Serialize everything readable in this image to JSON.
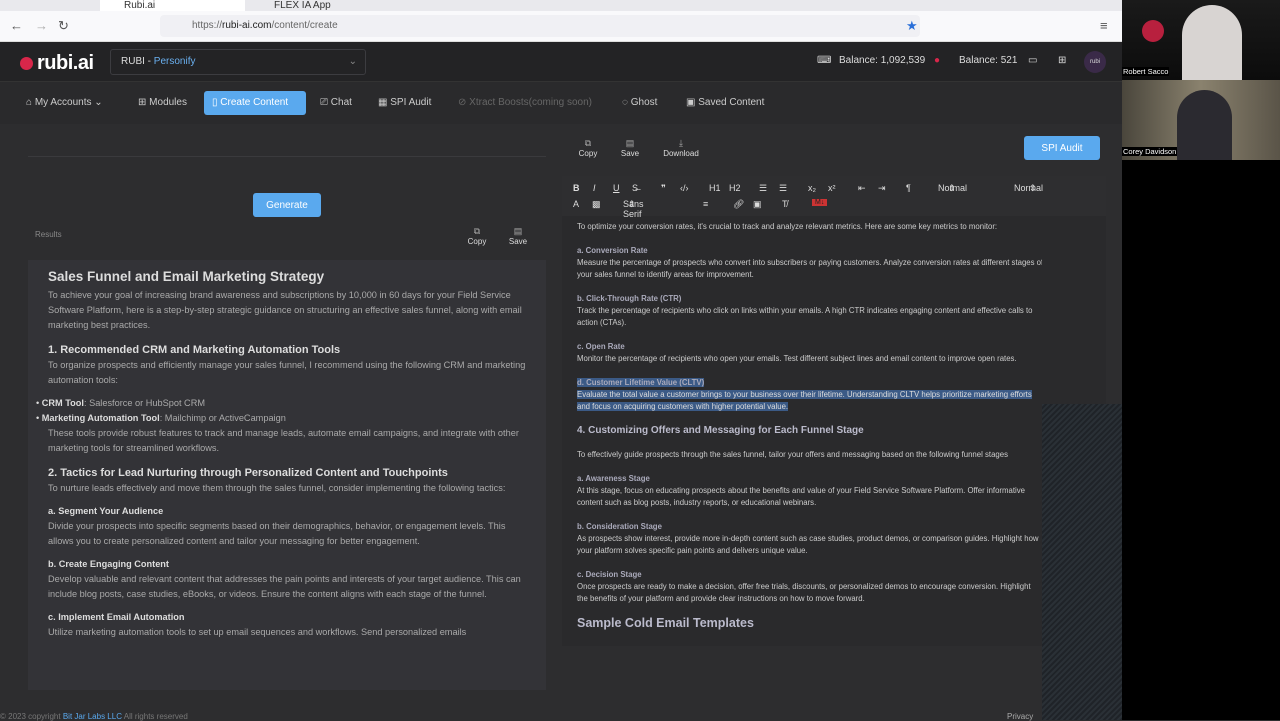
{
  "browser": {
    "tabs": [
      "Rubi.ai",
      "FLEX IA App"
    ],
    "url_domain": "rubi-ai.com",
    "url_path": "/content/create",
    "url_scheme": "https://"
  },
  "header": {
    "logo": "rubi.ai",
    "persona_prefix": "RUBI - ",
    "persona_name": "Personify",
    "balance_tokens": "Balance: 1,092,539",
    "balance_credits": "Balance: 521"
  },
  "nav": [
    {
      "label": "My Accounts ⌄",
      "icon": "home-icon"
    },
    {
      "label": "Modules",
      "icon": "grid-icon"
    },
    {
      "label": "Create Content",
      "icon": "document-icon",
      "active": true
    },
    {
      "label": "Chat",
      "icon": "chat-icon"
    },
    {
      "label": "SPI Audit",
      "icon": "map-icon"
    },
    {
      "label": "Xtract Boosts(coming soon)",
      "icon": "rocket-icon",
      "disabled": true
    },
    {
      "label": "Ghost",
      "icon": "ghost-icon"
    },
    {
      "label": "Saved Content",
      "icon": "save-icon"
    }
  ],
  "left": {
    "generate": "Generate",
    "results": "Results",
    "copy": "Copy",
    "save": "Save",
    "title": "Sales Funnel and Email Marketing Strategy",
    "intro": "To achieve your goal of increasing brand awareness and subscriptions by 10,000 in 60 days for your Field Service Software Platform, here is a step-by-step strategic guidance on structuring an effective sales funnel, along with email marketing best practices.",
    "s1": "1. Recommended CRM and Marketing Automation Tools",
    "s1p": "To organize prospects and efficiently manage your sales funnel, I recommend using the following CRM and marketing automation tools:",
    "b1k": "CRM Tool",
    "b1v": ": Salesforce or HubSpot CRM",
    "b2k": "Marketing Automation Tool",
    "b2v": ": Mailchimp or ActiveCampaign",
    "s1p2": "These tools provide robust features to track and manage leads, automate email campaigns, and integrate with other marketing tools for streamlined workflows.",
    "s2": "2. Tactics for Lead Nurturing through Personalized Content and Touchpoints",
    "s2p": "To nurture leads effectively and move them through the sales funnel, consider implementing the following tactics:",
    "a": "a. Segment Your Audience",
    "ap": "Divide your prospects into specific segments based on their demographics, behavior, or engagement levels. This allows you to create personalized content and tailor your messaging for better engagement.",
    "b": "b. Create Engaging Content",
    "bp": "Develop valuable and relevant content that addresses the pain points and interests of your target audience. This can include blog posts, case studies, eBooks, or videos. Ensure the content aligns with each stage of the funnel.",
    "c": "c. Implement Email Automation",
    "cp": "Utilize marketing automation tools to set up email sequences and workflows. Send personalized emails"
  },
  "right": {
    "copy": "Copy",
    "save": "Save",
    "download": "Download",
    "spi_audit": "SPI Audit",
    "font": "Sans Serif",
    "size1": "Normal",
    "size2": "Normal",
    "lines": [
      {
        "t": "To optimize your conversion rates, it's crucial to track and analyze relevant metrics. Here are some key metrics to monitor:"
      },
      {
        "h": "a. Conversion Rate",
        "t": "Measure the percentage of prospects who convert into subscribers or paying customers. Analyze conversion rates at different stages of",
        "t2": "your sales funnel to identify areas for improvement."
      },
      {
        "h": "b. Click-Through Rate (CTR)",
        "t": "Track the percentage of recipients who click on links within your emails. A high CTR indicates engaging content and effective calls to",
        "t2": "action (CTAs)."
      },
      {
        "h": "c. Open Rate",
        "t": "Monitor the percentage of recipients who open your emails. Test different subject lines and email content to improve open rates."
      }
    ],
    "sel_h": "d. Customer Lifetime Value (CLTV)",
    "sel_t": "Evaluate the total value a customer brings to your business over their lifetime. Understanding CLTV helps prioritize marketing efforts",
    "sel_t2": "and focus on acquiring customers with higher potential value.",
    "s4": "4. Customizing Offers and Messaging for Each Funnel Stage",
    "s4p": "To effectively guide prospects through the sales funnel, tailor your offers and messaging based on the following funnel stages",
    "stages": [
      {
        "h": "a. Awareness Stage",
        "t": "At this stage, focus on educating prospects about the benefits and value of your Field Service Software Platform. Offer informative",
        "t2": "content such as blog posts, industry reports, or educational webinars."
      },
      {
        "h": "b. Consideration Stage",
        "t": "As prospects show interest, provide more in-depth content such as case studies, product demos, or comparison guides. Highlight how",
        "t2": "your platform solves specific pain points and delivers unique value."
      },
      {
        "h": "c. Decision Stage",
        "t": "Once prospects are ready to make a decision, offer free trials, discounts, or personalized demos to encourage conversion. Highlight",
        "t2": "the benefits of your platform and provide clear instructions on how to move forward."
      }
    ],
    "h_email": "Sample Cold Email Templates"
  },
  "footer": {
    "pre": "© 2023 copyright ",
    "company": "Bit Jar Labs LLC",
    "post": " All rights reserved",
    "privacy": "Privacy"
  },
  "video": {
    "p1": "Robert Sacco",
    "p2": "Corey Davidson"
  },
  "colors": {
    "accent": "#5aa9ee",
    "brand": "#d8264a",
    "selection": "#3b5a86"
  }
}
